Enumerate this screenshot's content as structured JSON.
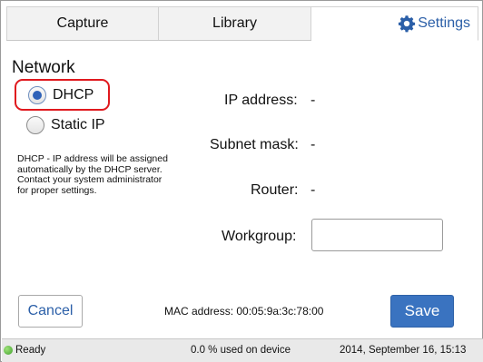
{
  "tabs": {
    "capture": "Capture",
    "library": "Library",
    "settings": "Settings",
    "settings_icon": "gear-icon"
  },
  "network": {
    "title": "Network",
    "dhcp_label": "DHCP",
    "static_label": "Static IP",
    "selected": "DHCP",
    "help": [
      "DHCP - IP address will be assigned automatically by the DHCP server.",
      "Contact your system administrator for proper settings."
    ]
  },
  "info": {
    "ip_label": "IP address:",
    "ip_value": "-",
    "subnet_label": "Subnet mask:",
    "subnet_value": "-",
    "router_label": "Router:",
    "router_value": "-",
    "workgroup_label": "Workgroup:",
    "workgroup_value": ""
  },
  "actions": {
    "cancel": "Cancel",
    "save": "Save",
    "mac": "MAC address: 00:05:9a:3c:78:00"
  },
  "status": {
    "ready": "Ready",
    "usage": "0.0 % used on device",
    "datetime": "2014, September 16, 15:13"
  },
  "colors": {
    "accent": "#2b5fa8",
    "save_button": "#3a73c0",
    "highlight_box": "#e0191e",
    "ready_dot": "#4caf3a"
  }
}
